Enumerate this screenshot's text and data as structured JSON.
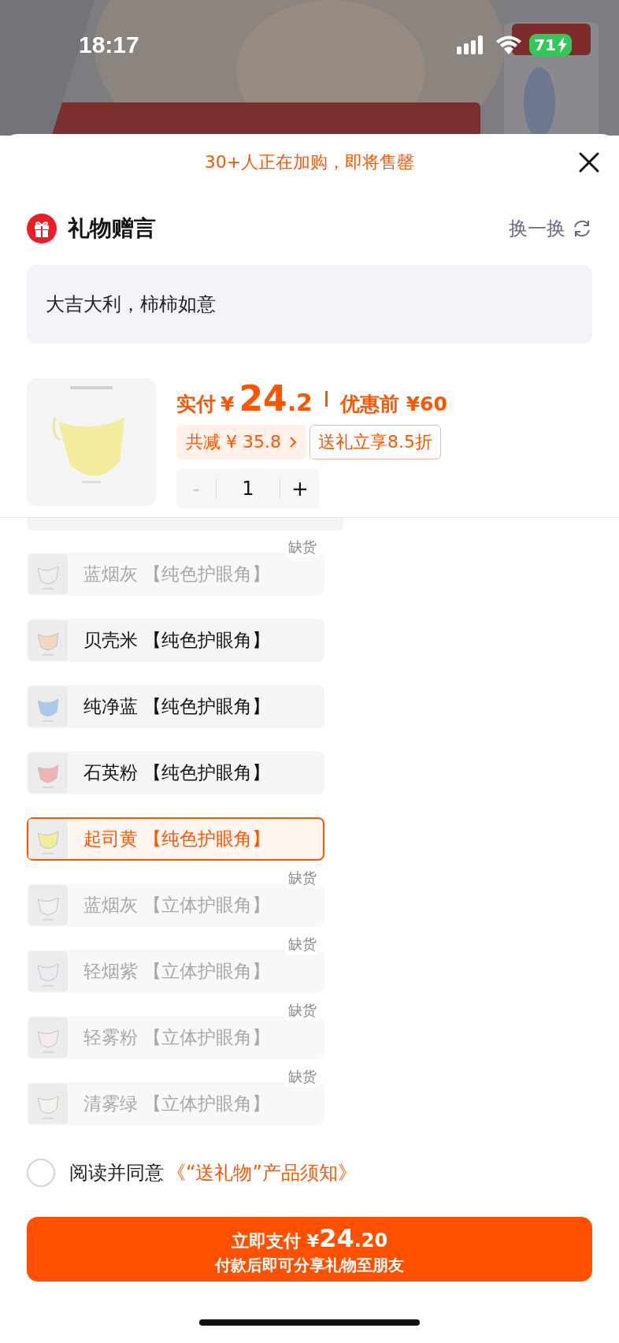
{
  "status_bar": {
    "time": "18:17",
    "battery": "71",
    "charging": true
  },
  "sheet": {
    "urgency": "30+人正在加购，即将售罄"
  },
  "gift_message": {
    "title": "礼物赠言",
    "refresh": "换一换",
    "message": "大吉大利，柿柿如意"
  },
  "product": {
    "price_label": "实付",
    "currency": "¥",
    "price_integer": "24",
    "price_decimal": ".2",
    "original_price": "优惠前 ¥60",
    "discount": "共减 ¥ 35.8",
    "gift_tag": "送礼立享8.5折",
    "quantity": {
      "minus": "-",
      "value": "1",
      "plus": "+",
      "minus_disabled": true
    }
  },
  "options": [
    {
      "name": "蓝烟灰",
      "variant": "【纯色护眼角】",
      "color": "#eeeeee",
      "disabled": true,
      "selected": false,
      "badge": "缺货"
    },
    {
      "name": "贝壳米",
      "variant": "【纯色护眼角】",
      "color": "#f2d6bd",
      "disabled": false,
      "selected": false
    },
    {
      "name": "纯净蓝",
      "variant": "【纯色护眼角】",
      "color": "#a8c8ec",
      "disabled": false,
      "selected": false
    },
    {
      "name": "石英粉",
      "variant": "【纯色护眼角】",
      "color": "#efb4b2",
      "disabled": false,
      "selected": false
    },
    {
      "name": "起司黄",
      "variant": "【纯色护眼角】",
      "color": "#f2ec9c",
      "disabled": false,
      "selected": true
    },
    {
      "name": "蓝烟灰",
      "variant": "【立体护眼角】",
      "color": "#f0f0f2",
      "disabled": true,
      "selected": false,
      "badge": "缺货"
    },
    {
      "name": "轻烟紫",
      "variant": "【立体护眼角】",
      "color": "#ebebf4",
      "disabled": true,
      "selected": false,
      "badge": "缺货"
    },
    {
      "name": "轻雾粉",
      "variant": "【立体护眼角】",
      "color": "#f8eaea",
      "disabled": true,
      "selected": false,
      "badge": "缺货"
    },
    {
      "name": "清雾绿",
      "variant": "【立体护眼角】",
      "color": "#eff3ea",
      "disabled": true,
      "selected": false,
      "badge": "缺货"
    }
  ],
  "agreement": {
    "checked": false,
    "text": "阅读并同意",
    "link": "《“送礼物”产品须知》"
  },
  "pay_button": {
    "label": "立即支付",
    "currency": "¥",
    "amount_integer": "24",
    "amount_decimal": ".20",
    "subtitle": "付款后即可分享礼物至朋友"
  }
}
